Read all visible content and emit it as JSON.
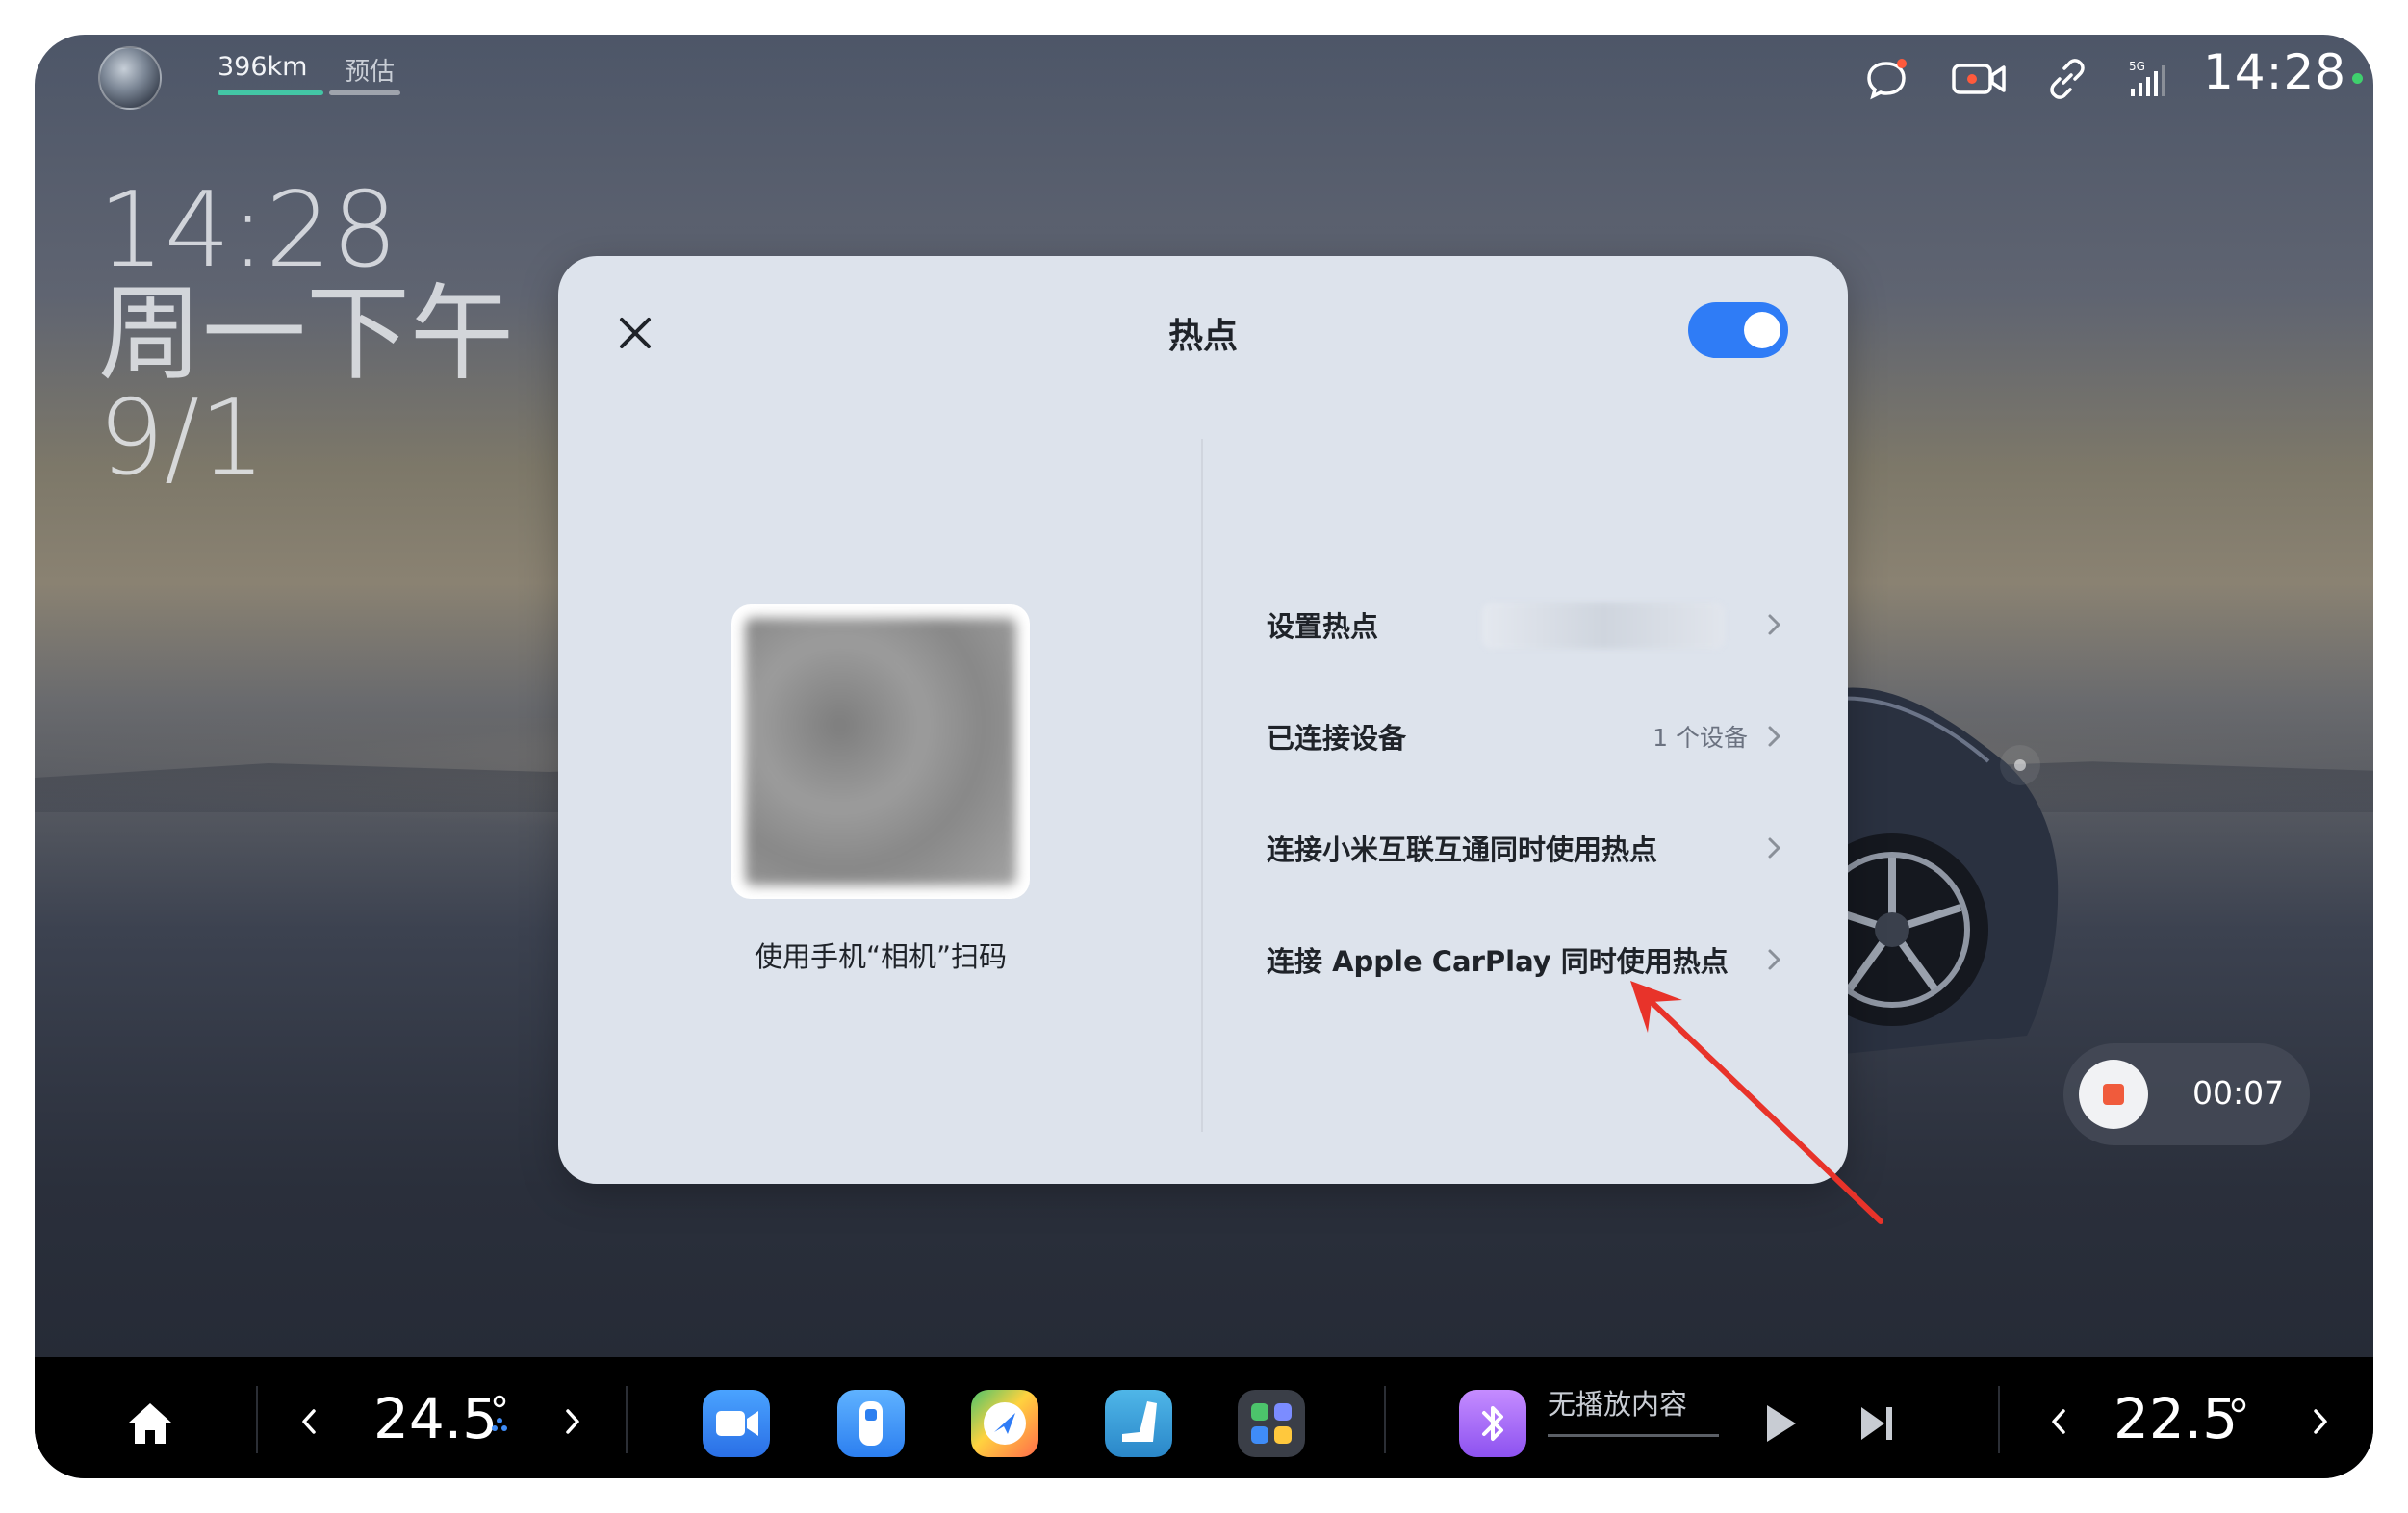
{
  "status_bar": {
    "range": "396km",
    "estimate_label": "预估",
    "time": "14:28",
    "icons": [
      "chat-icon",
      "camera-icon",
      "link-icon",
      "cellular-5g-icon"
    ],
    "signal_label": "5G"
  },
  "clock_widget": {
    "time": "14:28",
    "day": "周一下午",
    "date": "9/1"
  },
  "recording": {
    "elapsed": "00:07"
  },
  "modal": {
    "title": "热点",
    "toggle_on": true,
    "qr_caption": "使用手机“相机”扫码",
    "rows": [
      {
        "label": "设置热点",
        "value": ""
      },
      {
        "label": "已连接设备",
        "value": "1 个设备"
      },
      {
        "label": "连接小米互联互通同时使用热点",
        "value": ""
      },
      {
        "label": "连接 Apple CarPlay 同时使用热点",
        "value": ""
      }
    ]
  },
  "dock": {
    "temp_left": "24.5",
    "temp_right": "22.5",
    "media_status": "无播放内容",
    "apps": [
      "video-call-icon",
      "phone-key-icon",
      "navigation-icon",
      "seat-icon",
      "app-grid-icon"
    ]
  },
  "colors": {
    "toggle_accent": "#2f7cf6",
    "record_red": "#f05b3c",
    "range_bar": "#43c6a5",
    "status_dot": "#3fd06d",
    "annotation_arrow": "#e8332a"
  }
}
